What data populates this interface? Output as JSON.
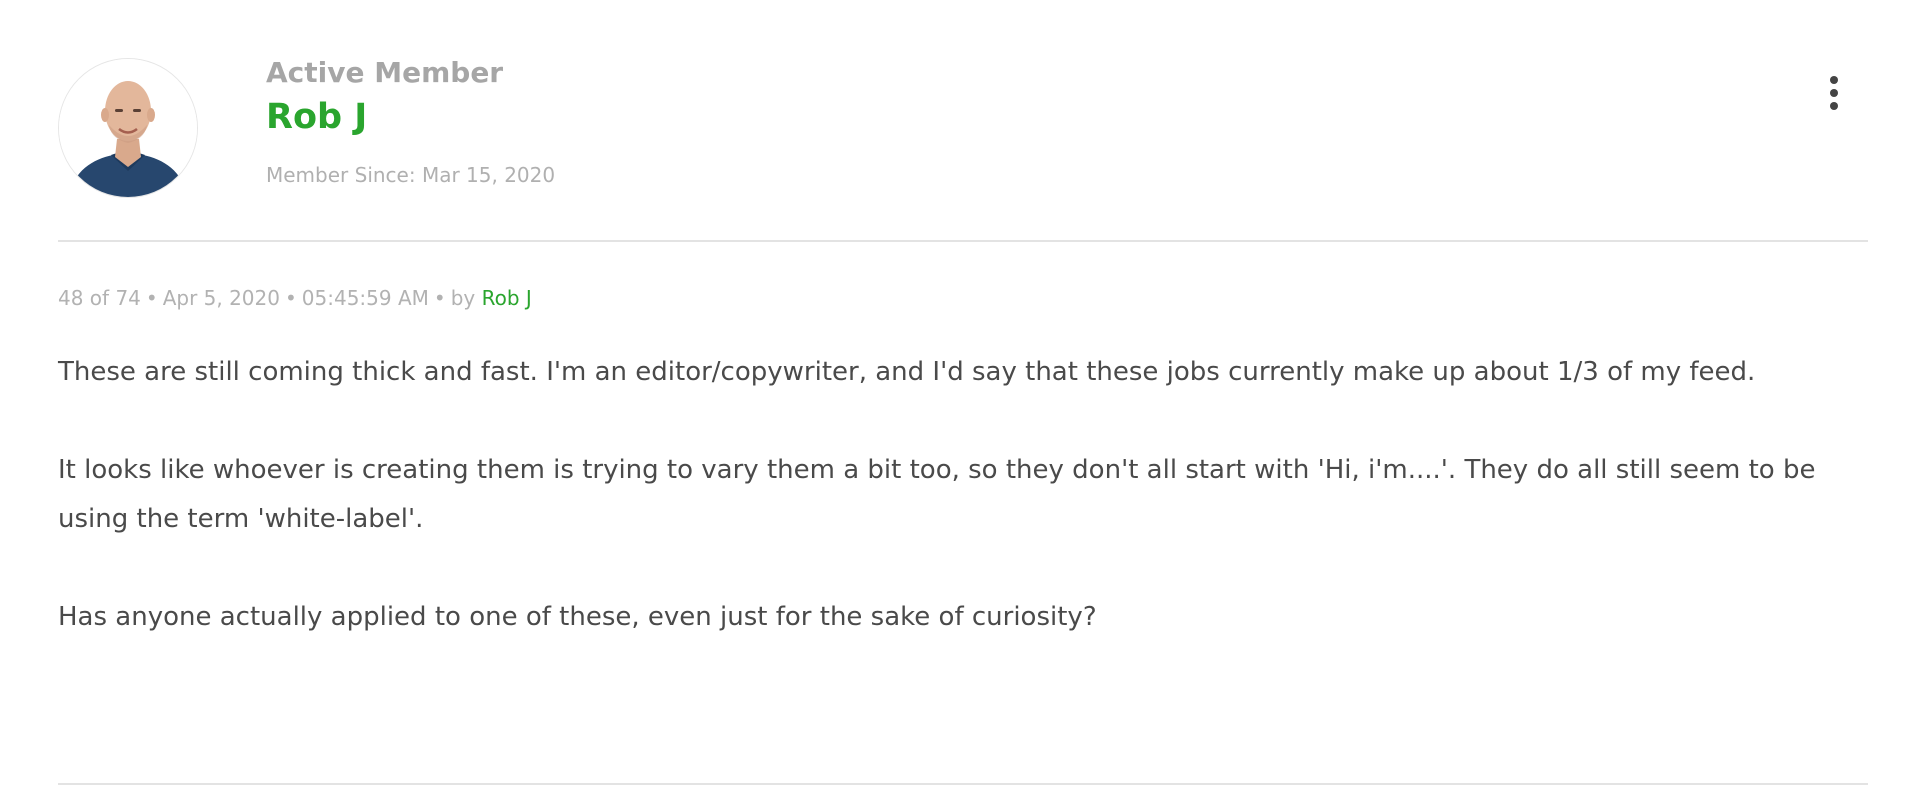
{
  "author": {
    "role": "Active Member",
    "name": "Rob J",
    "member_since": "Member Since: Mar 15, 2020"
  },
  "post_meta": {
    "position": "48 of 74",
    "date": "Apr 5, 2020",
    "time": "05:45:59 AM",
    "by_label": "by",
    "author": "Rob J"
  },
  "body": {
    "paragraphs": [
      "These are still coming thick and fast. I'm an editor/copywriter, and I'd say that these jobs currently make up about 1/3 of my feed.",
      "It looks like whoever is creating them is trying to vary them a bit too, so they don't all start with 'Hi, i'm....'. They do all still seem to be using the term 'white-label'.",
      "Has anyone actually applied to one of these, even just for the sake of curiosity?"
    ]
  },
  "icons": {
    "menu": "more-vertical-icon",
    "avatar": "user-photo"
  },
  "colors": {
    "accent_green": "#2aa52e",
    "muted_text": "#a6a6a6",
    "body_text": "#4a4a4a",
    "divider": "#e3e3e3"
  }
}
